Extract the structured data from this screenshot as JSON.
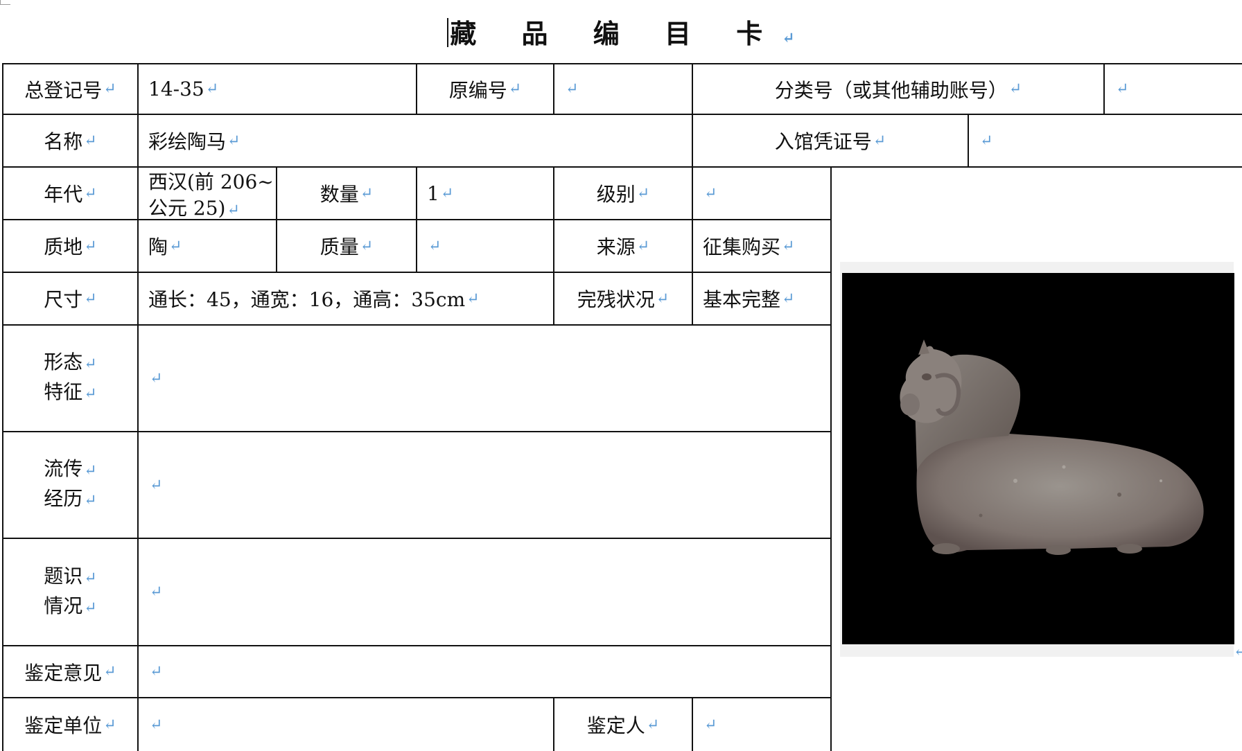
{
  "title": "藏 品 编 目 卡",
  "return_mark": "↵",
  "row1": {
    "reg_no_label": "总登记号",
    "reg_no_value": "14-35",
    "orig_no_label": "原编号",
    "orig_no_value": "",
    "class_no_label": "分类号（或其他辅助账号）",
    "class_no_value": ""
  },
  "row2": {
    "name_label": "名称",
    "name_value": "彩绘陶马",
    "voucher_label": "入馆凭证号",
    "voucher_value": ""
  },
  "row3": {
    "era_label": "年代",
    "era_value_line1": "西汉(前 206~",
    "era_value_line2": "公元 25)",
    "qty_label": "数量",
    "qty_value": "1",
    "grade_label": "级别",
    "grade_value": ""
  },
  "row4": {
    "material_label": "质地",
    "material_value": "陶",
    "weight_label": "质量",
    "weight_value": "",
    "source_label": "来源",
    "source_value": "征集购买"
  },
  "row5": {
    "size_label": "尺寸",
    "size_value": "通长：45，通宽：16，通高：35cm",
    "condition_label": "完残状况",
    "condition_value": "基本完整"
  },
  "row6": {
    "label_line1": "形态",
    "label_line2": "特征",
    "value": ""
  },
  "row7": {
    "label_line1": "流传",
    "label_line2": "经历",
    "value": ""
  },
  "row8": {
    "label_line1": "题识",
    "label_line2": "情况",
    "value": ""
  },
  "row9": {
    "label": "鉴定意见",
    "value": ""
  },
  "row10": {
    "unit_label": "鉴定单位",
    "unit_value": "",
    "person_label": "鉴定人",
    "person_value": ""
  },
  "photo": {
    "subject": "painted pottery horse",
    "background": "#000000"
  },
  "colors": {
    "border": "#111111",
    "return_mark": "#5b9bd5"
  }
}
